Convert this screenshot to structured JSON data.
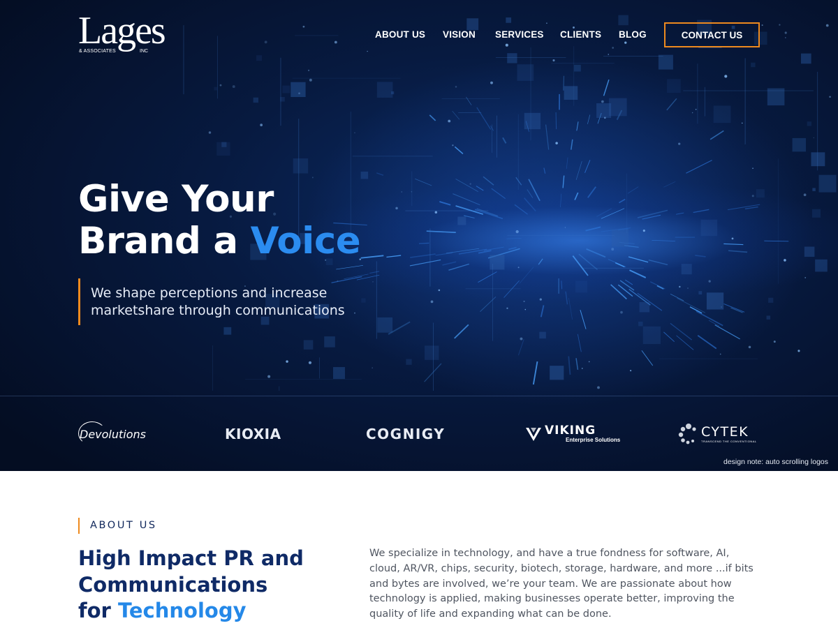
{
  "brand": {
    "name": "Lages",
    "sub": "& ASSOCIATES",
    "inc": "INC"
  },
  "nav": {
    "items": [
      {
        "label": "ABOUT US"
      },
      {
        "label": "VISION"
      },
      {
        "label": "SERVICES"
      },
      {
        "label": "CLIENTS"
      },
      {
        "label": "BLOG"
      }
    ],
    "contact_label": "CONTACT US",
    "contact_border_color": "#ee8a1e"
  },
  "hero": {
    "headline_line1": "Give Your",
    "headline_line2_prefix": "Brand a ",
    "headline_accent": "Voice",
    "accent_color": "#2b8cf0",
    "tagline": "We shape perceptions and increase marketshare through communications"
  },
  "clients": {
    "devolutions": "Devolutions",
    "kioxia": "KIOXIA",
    "cognigy": "COGNIGY",
    "viking": "VIKING",
    "viking_sub": "Enterprise Solutions",
    "cytek": "CYTEK",
    "cytek_sub": "TRANSCEND THE CONVENTIONAL",
    "design_note": "design note: auto scrolling logos"
  },
  "about": {
    "label": "ABOUT US",
    "title_line1": "High Impact PR and",
    "title_line2": "Communications",
    "title_line3_prefix": "for ",
    "title_accent": "Technology",
    "body": "We specialize in technology, and have a true fondness for software, AI, cloud, AR/VR, chips, security, biotech, storage, hardware, and more ...if bits and bytes are involved, we’re your team. We are passionate about how technology is applied, making businesses operate better, improving the quality of life and expanding what can be done."
  },
  "colors": {
    "navy": "#0f2a66",
    "orange": "#ee8a1e",
    "blue": "#2488e8",
    "hero_bg": "#071a40"
  }
}
